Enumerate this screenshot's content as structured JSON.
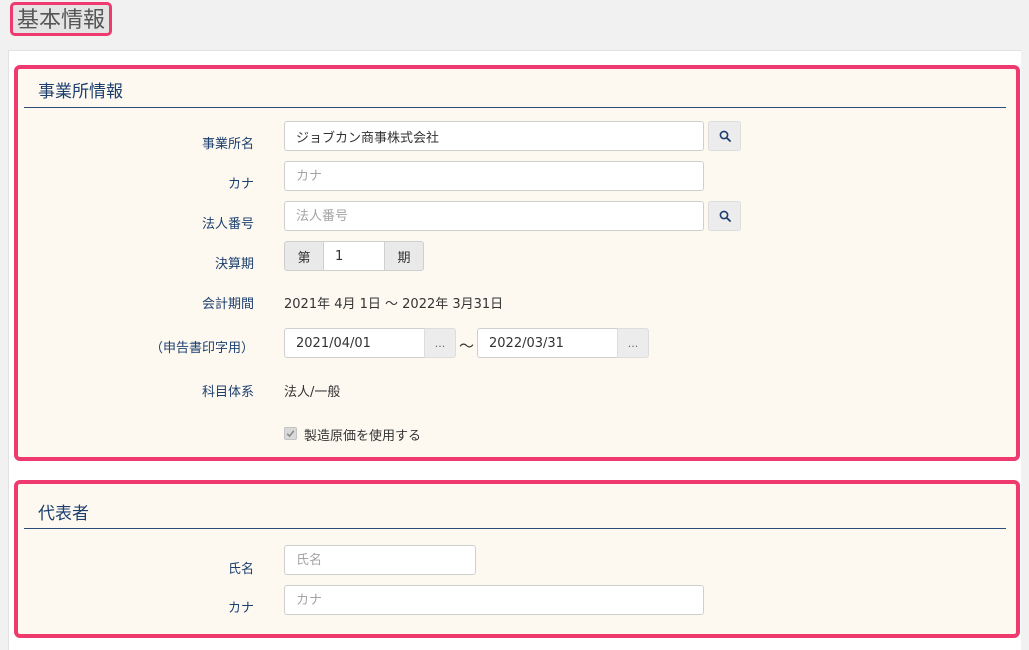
{
  "page": {
    "title": "基本情報"
  },
  "office_section": {
    "title": "事業所情報",
    "office_name": {
      "label": "事業所名",
      "value": "ジョブカン商事株式会社",
      "placeholder": ""
    },
    "kana": {
      "label": "カナ",
      "value": "",
      "placeholder": "カナ"
    },
    "corporate_number": {
      "label": "法人番号",
      "value": "",
      "placeholder": "法人番号"
    },
    "fiscal_term": {
      "label": "決算期",
      "prefix": "第",
      "value": "1",
      "suffix": "期"
    },
    "accounting_period": {
      "label": "会計期間",
      "text": "2021年 4月 1日 〜 2022年 3月31日"
    },
    "print_period": {
      "label": "（申告書印字用）",
      "start": "2021/04/01",
      "end": "2022/03/31",
      "separator": "〜",
      "picker_label": "..."
    },
    "account_system": {
      "label": "科目体系",
      "value": "法人/一般"
    },
    "manufacturing_cost": {
      "label": "製造原価を使用する",
      "checked": true,
      "disabled": true
    }
  },
  "representative_section": {
    "title": "代表者",
    "name": {
      "label": "氏名",
      "value": "",
      "placeholder": "氏名"
    },
    "kana": {
      "label": "カナ",
      "value": "",
      "placeholder": "カナ"
    }
  },
  "icons": {
    "search": "search-icon",
    "check": "check-icon"
  },
  "colors": {
    "highlight": "#ee3a6e",
    "label": "#1d3f6e",
    "section_bg": "#fdf9f0"
  }
}
